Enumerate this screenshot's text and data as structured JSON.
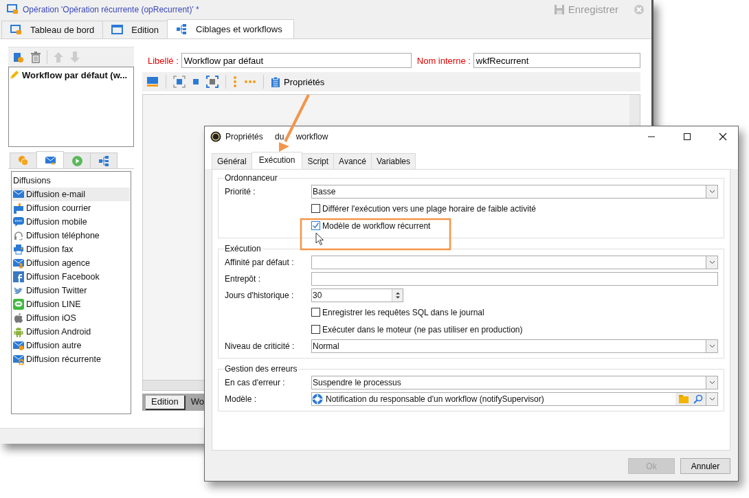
{
  "window": {
    "title": "Opération 'Opération récurrente (opRecurrent)' *",
    "save_button": {
      "label": "Enregistrer",
      "disabled": true
    }
  },
  "main_tabs": [
    {
      "label": "Tableau de bord",
      "selected": false
    },
    {
      "label": "Edition",
      "selected": false
    },
    {
      "label": "Ciblages et workflows",
      "selected": true
    }
  ],
  "workflows": [
    {
      "label": "Workflow par défaut (w..."
    }
  ],
  "left_tabs": [
    {
      "selected": false
    },
    {
      "selected": true
    },
    {
      "selected": false
    },
    {
      "selected": false
    }
  ],
  "diffusions": {
    "header": "Diffusions",
    "items": [
      {
        "label": "Diffusion e-mail",
        "selected": true
      },
      {
        "label": "Diffusion courrier",
        "selected": false
      },
      {
        "label": "Diffusion mobile",
        "selected": false
      },
      {
        "label": "Diffusion téléphone",
        "selected": false
      },
      {
        "label": "Diffusion fax",
        "selected": false
      },
      {
        "label": "Diffusion agence",
        "selected": false
      },
      {
        "label": "Diffusion Facebook",
        "selected": false
      },
      {
        "label": "Diffusion Twitter",
        "selected": false
      },
      {
        "label": "Diffusion LINE",
        "selected": false
      },
      {
        "label": "Diffusion iOS",
        "selected": false
      },
      {
        "label": "Diffusion Android",
        "selected": false
      },
      {
        "label": "Diffusion autre",
        "selected": false
      },
      {
        "label": "Diffusion récurrente",
        "selected": false
      }
    ]
  },
  "form": {
    "libelle": {
      "label": "Libellé :",
      "value": "Workflow par défaut"
    },
    "nom_interne": {
      "label": "Nom interne :",
      "value": "wkfRecurrent"
    }
  },
  "toolbar": {
    "properties_label": "Propriétés"
  },
  "bottom_tabs": [
    {
      "label": "Edition",
      "selected": true
    },
    {
      "label": "Wo",
      "selected": false
    }
  ],
  "dialog": {
    "title": "Propriétés du workflow",
    "tabs": [
      {
        "label": "Général",
        "selected": false
      },
      {
        "label": "Exécution",
        "selected": true
      },
      {
        "label": "Script",
        "selected": false
      },
      {
        "label": "Avancé",
        "selected": false
      },
      {
        "label": "Variables",
        "selected": false
      }
    ],
    "groups": [
      {
        "title": "Ordonnanceur",
        "rows": [
          {
            "kind": "select",
            "label": "Priorité :",
            "value": "Basse"
          },
          {
            "kind": "checkbox",
            "label": "Différer l'exécution vers une plage horaire de faible activité",
            "checked": false
          },
          {
            "kind": "checkbox",
            "label": "Modèle de workflow récurrent",
            "checked": true
          }
        ]
      },
      {
        "title": "Exécution",
        "rows": [
          {
            "kind": "select",
            "label": "Affinité par défaut :"
          },
          {
            "kind": "input",
            "label": "Entrepôt :"
          },
          {
            "kind": "spinner",
            "label": "Jours d'historique :",
            "value": "30"
          },
          {
            "kind": "checkbox",
            "label": "Enregistrer les requêtes SQL dans le journal",
            "checked": false
          },
          {
            "kind": "checkbox",
            "label": "Exécuter dans le moteur (ne pas utiliser en production)",
            "checked": false
          },
          {
            "kind": "select",
            "label": "Niveau de criticité :",
            "value": "Normal"
          }
        ]
      },
      {
        "title": "Gestion des erreurs",
        "rows": [
          {
            "kind": "select",
            "label": "En cas d'erreur :",
            "value": "Suspendre le processus"
          },
          {
            "kind": "link",
            "label": "Modèle :",
            "value": "Notification du responsable d'un workflow (notifySupervisor)"
          }
        ]
      }
    ],
    "buttons": [
      {
        "label": "Ok",
        "disabled": true
      },
      {
        "label": "Annuler",
        "disabled": false
      }
    ]
  }
}
